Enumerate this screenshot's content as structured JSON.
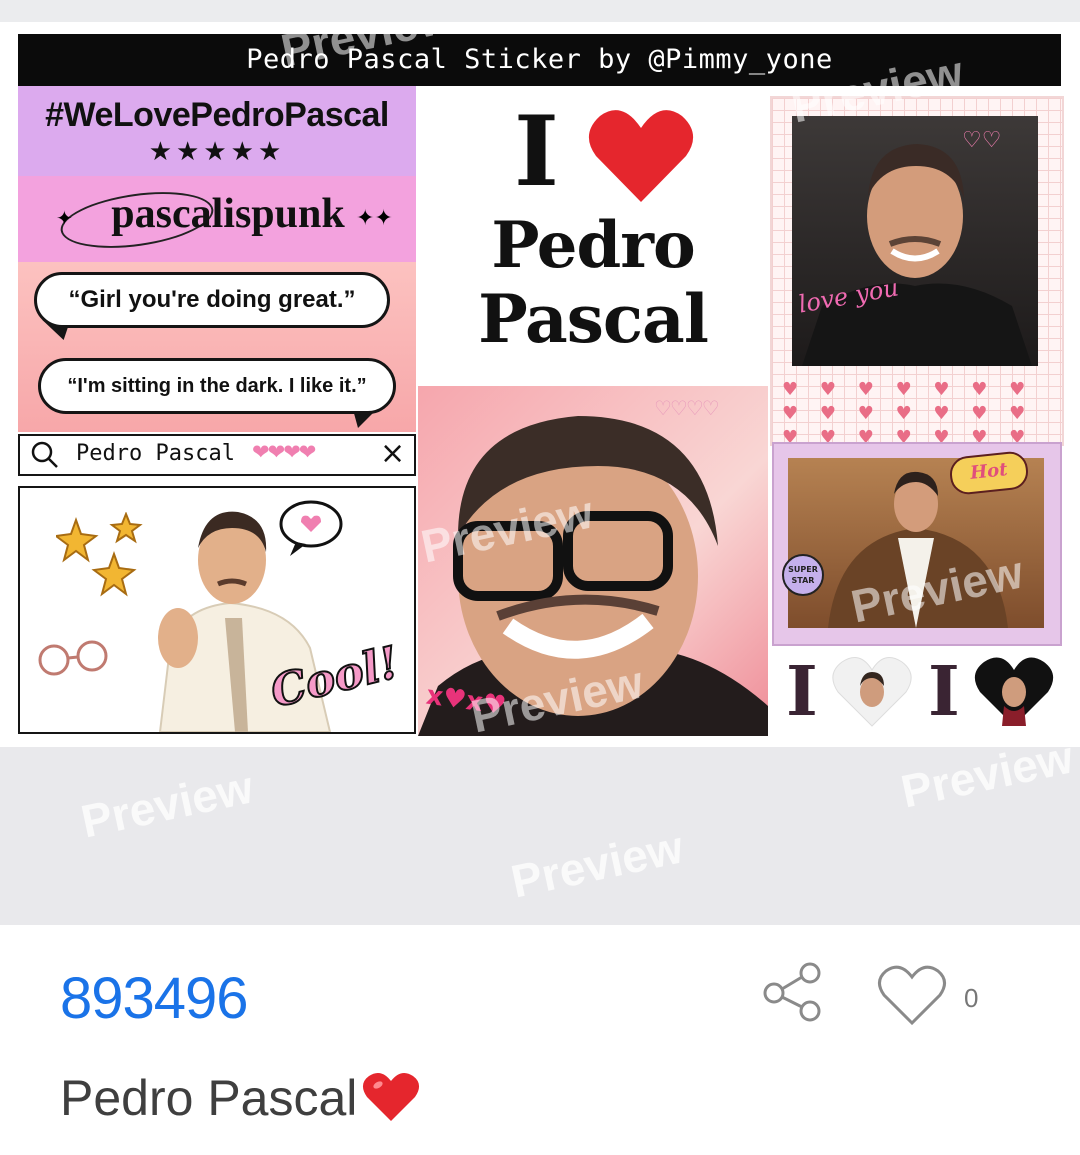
{
  "sticker_sheet": {
    "title": "Pedro Pascal Sticker by @Pimmy_yone",
    "hashtag": "#WeLovePedroPascal",
    "rating_stars": "★★★★★",
    "punk_text": "pascalispunk",
    "quote_1": "“Girl you're doing great.”",
    "quote_2": "“I'm sitting in the dark. I like it.”",
    "search_text": "Pedro Pascal",
    "search_hearts": "❤❤❤❤",
    "search_close": "×",
    "cool_text": "Cool!",
    "i_love": {
      "i": "I",
      "line1": "Pedro",
      "line2": "Pascal"
    },
    "polaroid_caption": "love you",
    "polaroid_hearts": "♥ ♥ ♥ ♥ ♥ ♥ ♥ ♥ ♥ ♥ ♥ ♥ ♥ ♥ ♥ ♥ ♥ ♥ ♥ ♥ ♥ ♥ ♥ ♥ ♥ ♥ ♥ ♥",
    "hot_badge": "Hot",
    "superstar_badge": "SUPER STAR",
    "xoxo": "x♥x♥",
    "mini_i_1": "I",
    "mini_i_2": "I",
    "watermark": "Preview"
  },
  "item": {
    "id": "893496",
    "name": "Pedro Pascal",
    "name_emoji": "heart-emoji",
    "like_count": "0",
    "share_icon": "share-icon",
    "like_icon": "heart-outline-icon"
  },
  "colors": {
    "id_blue": "#1a73e8",
    "heart_red": "#e5262d",
    "gap_gray": "#e9e9ec"
  }
}
